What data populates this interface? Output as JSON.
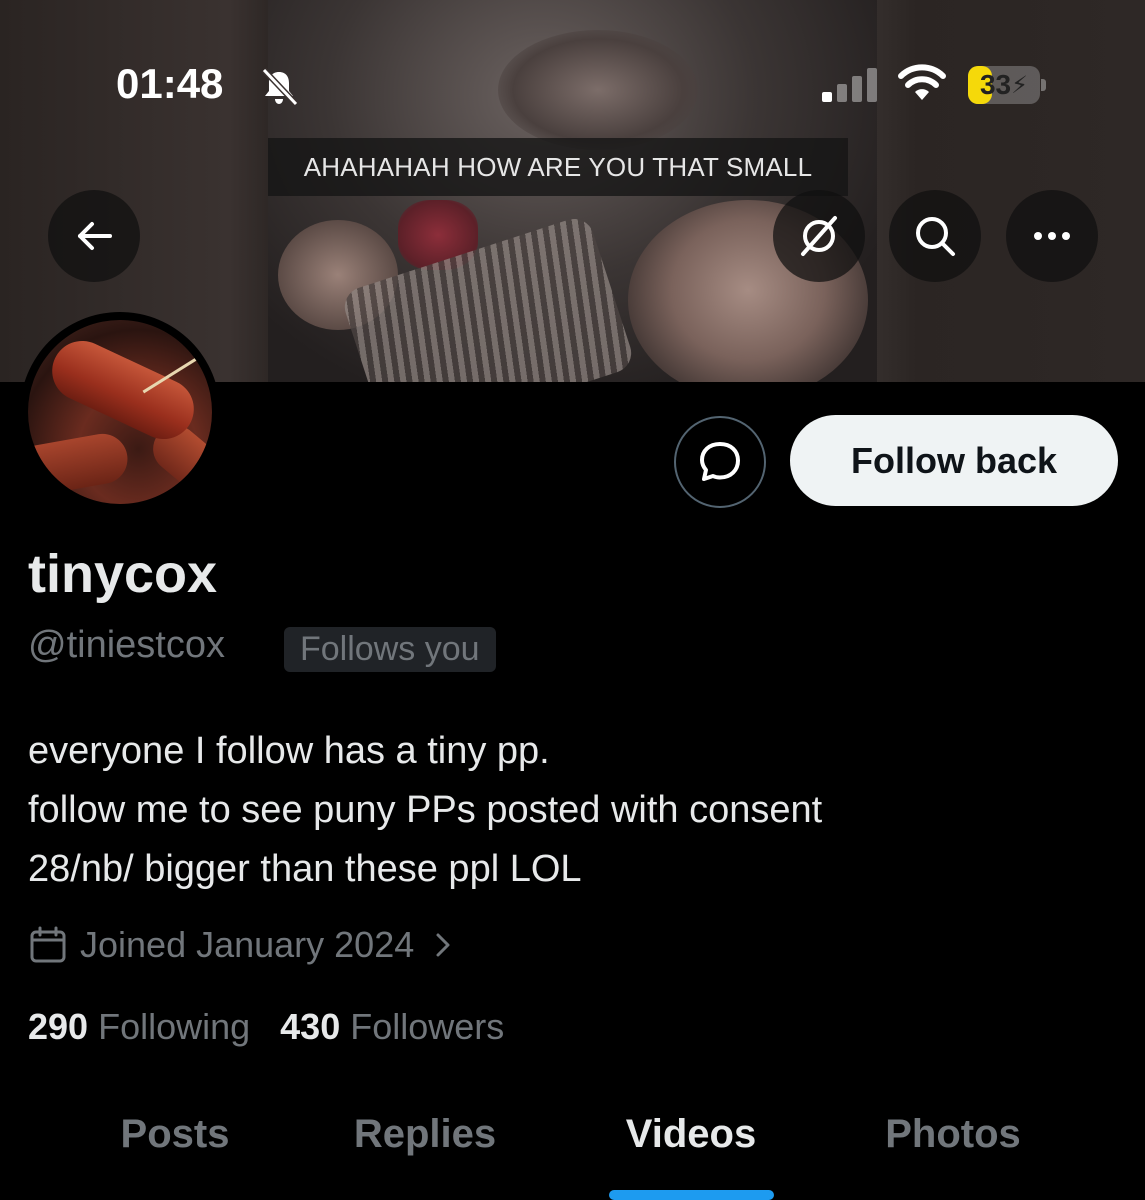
{
  "status_bar": {
    "time": "01:48",
    "icons": [
      "bell-slash-icon",
      "signal-icon",
      "wifi-icon"
    ],
    "battery": {
      "text": "33",
      "level": 0.33,
      "color": "#f5d90a"
    }
  },
  "banner": {
    "caption": "AHAHAHAH HOW ARE YOU THAT SMALL"
  },
  "header_buttons": [
    "back-arrow-icon",
    "hide-reposts-icon",
    "search-icon",
    "more-icon"
  ],
  "profile": {
    "display_name": "tinycox",
    "handle": "@tiniestcox",
    "follows_you_badge": "Follows you",
    "bio_lines": [
      "everyone I follow has a tiny pp.",
      "follow me to see puny PPs posted with consent",
      "28/nb/ bigger than these ppl LOL"
    ],
    "joined": "Joined January 2024",
    "following_count": "290",
    "following_label": "Following",
    "followers_count": "430",
    "followers_label": "Followers"
  },
  "actions": {
    "follow_back_label": "Follow back"
  },
  "tabs": [
    {
      "label": "Posts",
      "active": false
    },
    {
      "label": "Replies",
      "active": false
    },
    {
      "label": "Videos",
      "active": true
    },
    {
      "label": "Photos",
      "active": false
    }
  ],
  "colors": {
    "accent": "#1d9bf0",
    "muted_text": "#71767b",
    "primary_text": "#e7e9ea",
    "background": "#000000"
  }
}
